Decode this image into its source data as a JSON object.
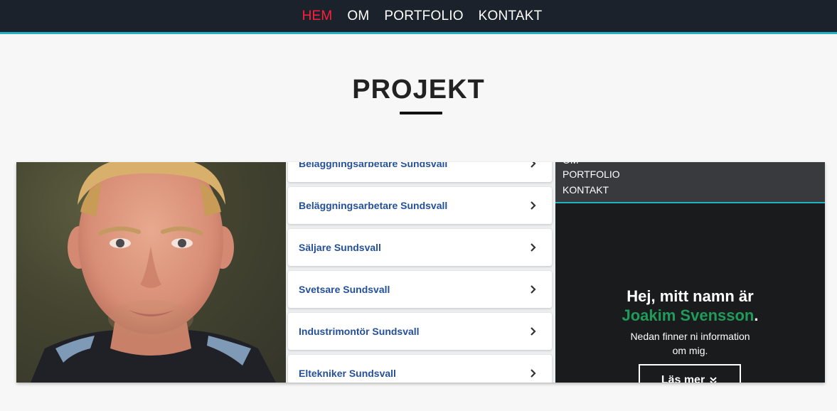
{
  "nav": {
    "items": [
      {
        "label": "HEM",
        "active": true
      },
      {
        "label": "OM",
        "active": false
      },
      {
        "label": "PORTFOLIO",
        "active": false
      },
      {
        "label": "KONTAKT",
        "active": false
      }
    ]
  },
  "section": {
    "title": "PROJEKT"
  },
  "projects": {
    "jobs": {
      "items": [
        "Beläggningsarbetare Sundsvall",
        "Beläggningsarbetare Sundsvall",
        "Säljare Sundsvall",
        "Svetsare Sundsvall",
        "Industrimontör Sundsvall",
        "Eltekniker Sundsvall"
      ]
    },
    "site": {
      "menu": [
        "OM",
        "PORTFOLIO",
        "KONTAKT"
      ],
      "heading": "Hej, mitt namn är",
      "name": "Joakim Svensson",
      "name_suffix": ".",
      "text_line1": "Nedan finner ni information",
      "text_line2": "om mig.",
      "button_label": "Läs mer",
      "button_icon": "double-chevron-down-icon"
    }
  },
  "colors": {
    "nav_bg": "#1b222b",
    "nav_active": "#ff1f3d",
    "accent_line": "#22b2c4",
    "job_text": "#24509a",
    "name_green": "#1f9b5a"
  }
}
